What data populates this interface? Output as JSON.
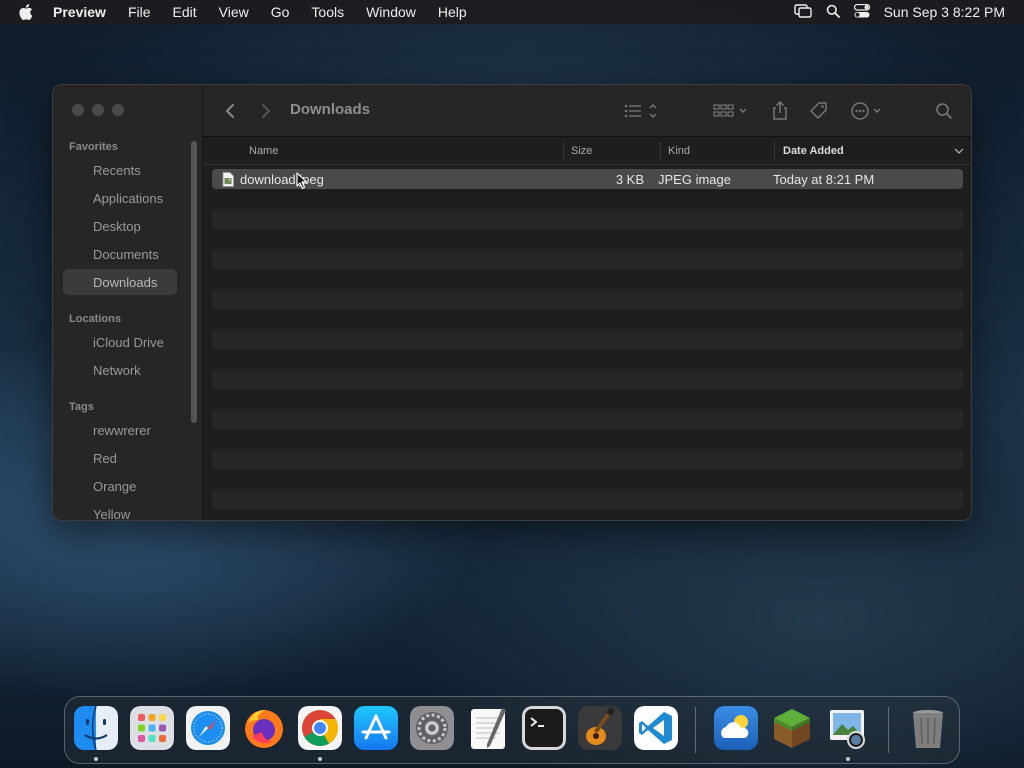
{
  "menubar": {
    "app_name": "Preview",
    "menus": [
      "File",
      "Edit",
      "View",
      "Go",
      "Tools",
      "Window",
      "Help"
    ],
    "clock": "Sun Sep 3  8:22 PM"
  },
  "window": {
    "title": "Downloads",
    "sidebar": {
      "favorites_title": "Favorites",
      "favorites": [
        "Recents",
        "Applications",
        "Desktop",
        "Documents",
        "Downloads"
      ],
      "selected": "Downloads",
      "locations_title": "Locations",
      "locations": [
        "iCloud Drive",
        "Network"
      ],
      "tags_title": "Tags",
      "tags": [
        "rewwrerer",
        "Red",
        "Orange",
        "Yellow"
      ]
    },
    "columns": {
      "name": "Name",
      "size": "Size",
      "kind": "Kind",
      "date_added": "Date Added"
    },
    "files": [
      {
        "name": "download.jpeg",
        "size": "3 KB",
        "kind": "JPEG image",
        "date_added": "Today at 8:21 PM"
      }
    ]
  },
  "dock": {
    "apps": [
      "Finder",
      "Launchpad",
      "Safari",
      "Firefox",
      "Chrome",
      "App Store",
      "System Settings",
      "TextEdit",
      "Terminal",
      "GarageBand",
      "Visual Studio Code",
      "Weather",
      "Minecraft",
      "Preview",
      "Trash"
    ]
  },
  "colors": {
    "accent": "#3b82f6",
    "window_bg": "#1e1e1e",
    "selected_row": "#4a4a4a"
  }
}
